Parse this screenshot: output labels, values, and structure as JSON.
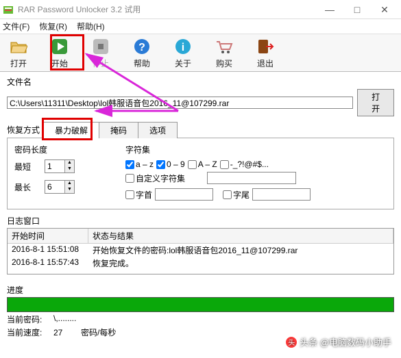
{
  "window": {
    "title": "RAR Password Unlocker 3.2 试用",
    "min": "—",
    "max": "□",
    "close": "✕"
  },
  "menu": {
    "file": "文件(F)",
    "recover": "恢复(R)",
    "help": "帮助(H)"
  },
  "toolbar": {
    "open": "打开",
    "start": "开始",
    "stop": "停止",
    "helpbtn": "帮助",
    "about": "关于",
    "buy": "购买",
    "exit": "退出"
  },
  "file": {
    "label": "文件名",
    "path": "C:\\Users\\11311\\Desktop\\lol韩服语音包2016_11@107299.rar",
    "openbtn": "打开"
  },
  "tabs": {
    "pre": "恢复方式",
    "brute": "暴力破解",
    "mask": "掩码",
    "options": "选项"
  },
  "panel": {
    "pwlen": "密码长度",
    "min": "最短",
    "minval": "1",
    "max": "最长",
    "maxval": "6",
    "charset": "字符集",
    "lc": "a – z",
    "digits": "0 – 9",
    "uc": "A – Z",
    "special": "-_?!@#$...",
    "custom": "自定义字符集",
    "prefix": "字首",
    "suffix": "字尾"
  },
  "log": {
    "title": "日志窗口",
    "col_time": "开始时间",
    "col_msg": "状态与结果",
    "r1t": "2016-8-1 15:51:08",
    "r1m": "开始恢复文件的密码:lol韩服语音包2016_11@107299.rar",
    "r2t": "2016-8-1 15:57:43",
    "r2m": "恢复完成。"
  },
  "progress": {
    "label": "进度"
  },
  "stats": {
    "curpw_label": "当前密码:",
    "curpw_val": "\\,........",
    "speed_label": "当前速度:",
    "speed_val": "27",
    "speed_unit": "密码/每秒"
  },
  "watermark": "头条 @电脑数码小助手"
}
